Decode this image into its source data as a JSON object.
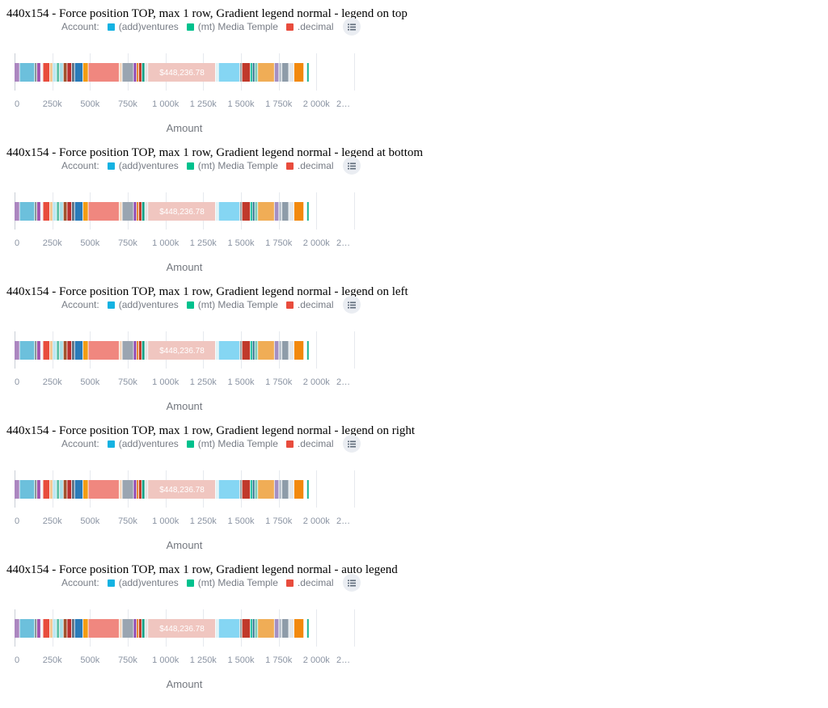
{
  "sections": [
    {
      "title": "440x154 - Force position TOP, max 1 row, Gradient legend normal - legend on top"
    },
    {
      "title": "440x154 - Force position TOP, max 1 row, Gradient legend normal - legend at bottom"
    },
    {
      "title": "440x154 - Force position TOP, max 1 row, Gradient legend normal - legend on left"
    },
    {
      "title": "440x154 - Force position TOP, max 1 row, Gradient legend normal - legend on right"
    },
    {
      "title": "440x154 - Force position TOP, max 1 row, Gradient legend normal - auto legend"
    }
  ],
  "legend": {
    "title": "Account:",
    "items": [
      {
        "label": "(add)ventures",
        "color": "#14b2e2"
      },
      {
        "label": "(mt) Media Temple",
        "color": "#00c18d"
      },
      {
        "label": ".decimal",
        "color": "#e84c3d"
      }
    ],
    "toggle_icon": "list-icon"
  },
  "chart_data": {
    "type": "bar",
    "orientation": "horizontal",
    "stacked": true,
    "total_label": "$448,236.78",
    "highlighted_segment_color": "#f0c6c0",
    "xlabel": "Amount",
    "ylabel": "",
    "xlim": [
      0,
      2250000
    ],
    "x_ticks": [
      "0",
      "250k",
      "500k",
      "750k",
      "1 000k",
      "1 250k",
      "1 500k",
      "1 750k",
      "2 000k",
      "2…"
    ],
    "grid": true,
    "segments": [
      {
        "value": 35000,
        "color": "#ab86c0"
      },
      {
        "value": 100000,
        "color": "#6cc0dc"
      },
      {
        "value": 15000,
        "color": "#7f8c8d"
      },
      {
        "value": 25000,
        "color": "#a355b0"
      },
      {
        "value": 15000,
        "color": "#f3f3f3"
      },
      {
        "value": 45000,
        "color": "#e84c3d"
      },
      {
        "value": 20000,
        "color": "#f5c58f"
      },
      {
        "value": 25000,
        "color": "#bde8f1"
      },
      {
        "value": 20000,
        "color": "#5dc0a6"
      },
      {
        "value": 25000,
        "color": "#a9dfe8"
      },
      {
        "value": 25000,
        "color": "#a0522d"
      },
      {
        "value": 30000,
        "color": "#bb2f2f"
      },
      {
        "value": 20000,
        "color": "#607080"
      },
      {
        "value": 55000,
        "color": "#2b7bb9"
      },
      {
        "value": 35000,
        "color": "#f39c12"
      },
      {
        "value": 205000,
        "color": "#f0877f"
      },
      {
        "value": 20000,
        "color": "#f5d7bd"
      },
      {
        "value": 75000,
        "color": "#9aa5b1"
      },
      {
        "value": 20000,
        "color": "#8e44ad"
      },
      {
        "value": 15000,
        "color": "#e67e22"
      },
      {
        "value": 20000,
        "color": "#c0392b"
      },
      {
        "value": 20000,
        "color": "#16a085"
      },
      {
        "value": 20000,
        "color": "#e3e3e3"
      },
      {
        "value": 448236.78,
        "color": "#f0c6c0"
      },
      {
        "value": 20000,
        "color": "#dff3f7"
      },
      {
        "value": 140000,
        "color": "#85d6f3"
      },
      {
        "value": 15000,
        "color": "#95a5a6"
      },
      {
        "value": 55000,
        "color": "#c0392b"
      },
      {
        "value": 15000,
        "color": "#1abc9c"
      },
      {
        "value": 15000,
        "color": "#2c6e8f"
      },
      {
        "value": 20000,
        "color": "#7fcdbb"
      },
      {
        "value": 110000,
        "color": "#f0ad56"
      },
      {
        "value": 30000,
        "color": "#a48fc2"
      },
      {
        "value": 20000,
        "color": "#b8c2cc"
      },
      {
        "value": 45000,
        "color": "#8e9ca9"
      },
      {
        "value": 35000,
        "color": "#e2e6ea"
      },
      {
        "value": 65000,
        "color": "#f2890d"
      },
      {
        "value": 20000,
        "color": "#fdfdfd"
      },
      {
        "value": 15000,
        "color": "#1ab394"
      }
    ]
  }
}
